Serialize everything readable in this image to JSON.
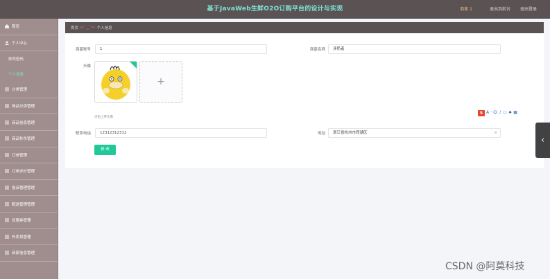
{
  "header": {
    "title": "基于JavaWeb生鲜O2O订购平台的设计与实现",
    "user": "商家 1",
    "exit_to_front": "退出到前台",
    "logout": "退出登录"
  },
  "sidebar": {
    "items": [
      {
        "label": "首页"
      },
      {
        "label": "个人中心"
      },
      {
        "label": "修改密码",
        "sub": true
      },
      {
        "label": "个人信息",
        "sub": true,
        "active": true
      },
      {
        "label": "分类管理"
      },
      {
        "label": "商品分类管理"
      },
      {
        "label": "商品信息管理"
      },
      {
        "label": "商品秒杀管理"
      },
      {
        "label": "订单管理"
      },
      {
        "label": "订单评价管理"
      },
      {
        "label": "投诉管理管理"
      },
      {
        "label": "配送管理管理"
      },
      {
        "label": "优惠券管理"
      },
      {
        "label": "外卖员管理"
      },
      {
        "label": "商家信息管理"
      }
    ]
  },
  "breadcrumb": {
    "home": "首页",
    "separator": "(•ˇ‿ˇ•)",
    "current": "个人信息"
  },
  "form": {
    "merchant_account_label": "商家账号",
    "merchant_account_value": "1",
    "merchant_name_label": "商家名称",
    "merchant_name_value": "涉奶者",
    "avatar_label": "头像",
    "upload_tip": "点击上传头像",
    "phone_label": "联系电话",
    "phone_value": "12312312312",
    "address_label": "地址",
    "address_value": "浙江省杭州市西湖区",
    "submit_label": "修 改"
  },
  "edge_button": "‹",
  "watermark": "CSDN @阿莫科技",
  "colors": {
    "topbar": "#5a5253",
    "sidebar": "#a08e8e",
    "accent": "#20c997",
    "title": "#7fe3d3"
  }
}
